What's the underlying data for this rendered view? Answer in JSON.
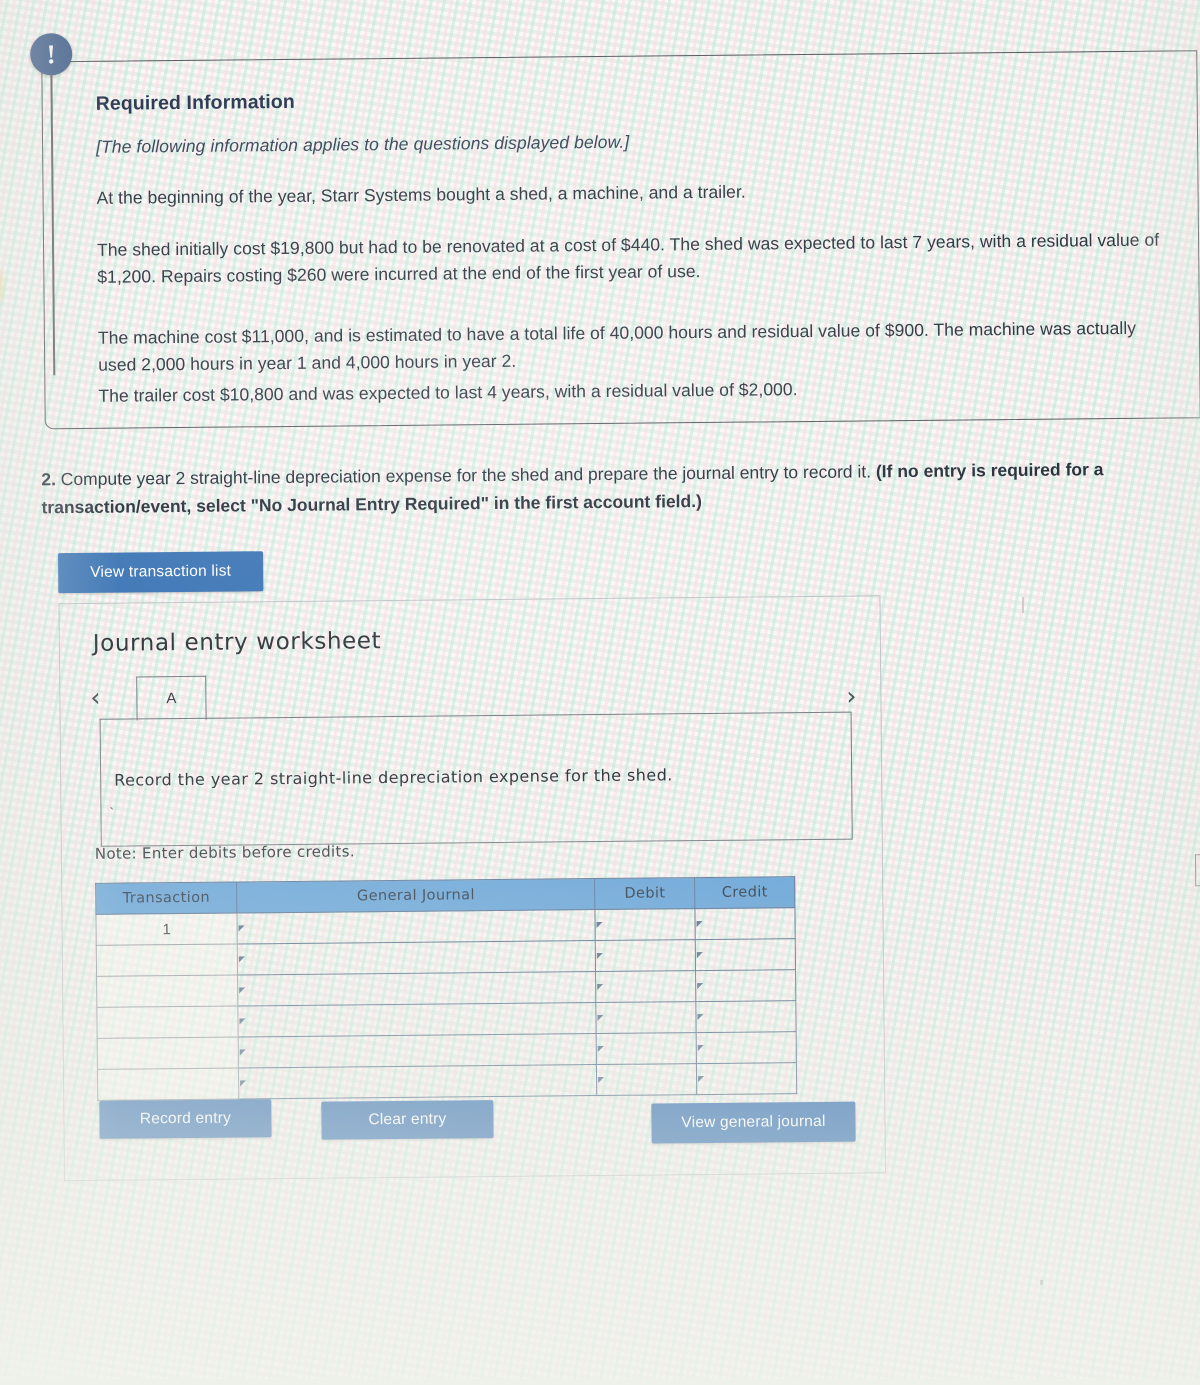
{
  "alert": {
    "icon": "exclamation-icon",
    "glyph": "!"
  },
  "info_card": {
    "title": "Required Information",
    "italic_note": "[The following information applies to the questions displayed below.]",
    "paragraphs": [
      "At the beginning of the year, Starr Systems bought a shed, a machine, and a trailer.",
      "The shed initially cost $19,800 but had to be renovated at a cost of $440. The shed was expected to last 7 years, with a residual value of $1,200. Repairs costing $260 were incurred at the end of the first year of use.",
      "The machine cost $11,000, and is estimated to have a total life of 40,000 hours and residual value of $900. The machine was actually used 2,000 hours in year 1 and 4,000 hours in year 2.",
      "The trailer cost $10,800 and was expected to last 4 years, with a residual value of $2,000."
    ]
  },
  "question": {
    "number": "2.",
    "text_plain": " Compute year 2 straight-line depreciation expense for the shed and prepare the journal entry to record it. ",
    "text_bold": "(If no entry is required for a transaction/event, select \"No Journal Entry Required\" in the first account field.)"
  },
  "toolbar": {
    "view_transaction_list": "View transaction list"
  },
  "worksheet": {
    "title": "Journal entry worksheet",
    "prev_arrow": "‹",
    "next_arrow": "›",
    "tabs": [
      {
        "label": "A",
        "active": true
      }
    ],
    "instruction": "Record the year 2 straight-line depreciation expense for the shed.",
    "note": "Note: Enter debits before credits.",
    "table": {
      "headers": [
        "Transaction",
        "General Journal",
        "Debit",
        "Credit"
      ],
      "rows": [
        {
          "transaction": "1",
          "general_journal": "",
          "debit": "",
          "credit": ""
        },
        {
          "transaction": "",
          "general_journal": "",
          "debit": "",
          "credit": ""
        },
        {
          "transaction": "",
          "general_journal": "",
          "debit": "",
          "credit": ""
        },
        {
          "transaction": "",
          "general_journal": "",
          "debit": "",
          "credit": ""
        },
        {
          "transaction": "",
          "general_journal": "",
          "debit": "",
          "credit": ""
        },
        {
          "transaction": "",
          "general_journal": "",
          "debit": "",
          "credit": ""
        }
      ]
    },
    "buttons": {
      "record_entry": "Record entry",
      "clear_entry": "Clear entry",
      "view_general_journal": "View general journal"
    }
  },
  "colors": {
    "button_blue": "#2f6cb0",
    "table_header_blue": "#5d9ed6",
    "badge_navy": "#3d5a87",
    "text_dark": "#1b2430"
  }
}
